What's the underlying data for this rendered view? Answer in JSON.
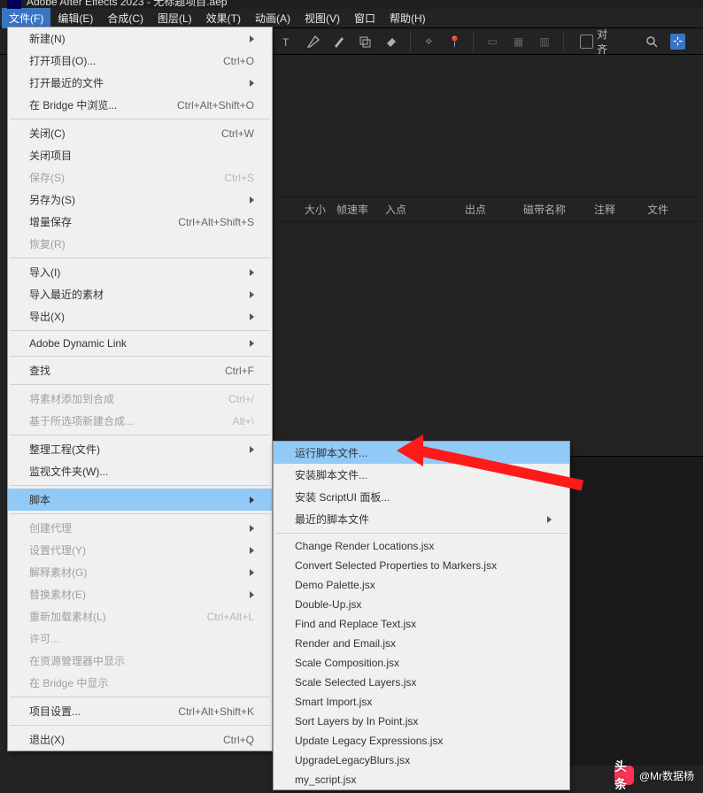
{
  "titlebar": {
    "app": "Adobe After Effects 2023",
    "project": "无标题项目.aep"
  },
  "menubar": {
    "items": [
      {
        "label": "文件(F)",
        "active": true
      },
      {
        "label": "编辑(E)"
      },
      {
        "label": "合成(C)"
      },
      {
        "label": "图层(L)"
      },
      {
        "label": "效果(T)"
      },
      {
        "label": "动画(A)"
      },
      {
        "label": "视图(V)"
      },
      {
        "label": "窗口"
      },
      {
        "label": "帮助(H)"
      }
    ]
  },
  "toolbar": {
    "align_label": "对齐"
  },
  "file_menu": {
    "items": [
      {
        "label": "新建(N)",
        "submenu": true
      },
      {
        "label": "打开项目(O)...",
        "shortcut": "Ctrl+O"
      },
      {
        "label": "打开最近的文件",
        "submenu": true
      },
      {
        "label": "在 Bridge 中浏览...",
        "shortcut": "Ctrl+Alt+Shift+O"
      },
      {
        "sep": true
      },
      {
        "label": "关闭(C)",
        "shortcut": "Ctrl+W"
      },
      {
        "label": "关闭项目"
      },
      {
        "label": "保存(S)",
        "shortcut": "Ctrl+S",
        "disabled": true
      },
      {
        "label": "另存为(S)",
        "submenu": true
      },
      {
        "label": "增量保存",
        "shortcut": "Ctrl+Alt+Shift+S"
      },
      {
        "label": "恢复(R)",
        "disabled": true
      },
      {
        "sep": true
      },
      {
        "label": "导入(I)",
        "submenu": true
      },
      {
        "label": "导入最近的素材",
        "submenu": true
      },
      {
        "label": "导出(X)",
        "submenu": true
      },
      {
        "sep": true
      },
      {
        "label": "Adobe Dynamic Link",
        "submenu": true
      },
      {
        "sep": true
      },
      {
        "label": "查找",
        "shortcut": "Ctrl+F"
      },
      {
        "sep": true
      },
      {
        "label": "将素材添加到合成",
        "shortcut": "Ctrl+/",
        "disabled": true
      },
      {
        "label": "基于所选项新建合成...",
        "shortcut": "Alt+\\",
        "disabled": true
      },
      {
        "sep": true
      },
      {
        "label": "整理工程(文件)",
        "submenu": true
      },
      {
        "label": "监视文件夹(W)..."
      },
      {
        "sep": true
      },
      {
        "label": "脚本",
        "submenu": true,
        "highlighted": true
      },
      {
        "sep": true
      },
      {
        "label": "创建代理",
        "submenu": true,
        "disabled": true
      },
      {
        "label": "设置代理(Y)",
        "submenu": true,
        "disabled": true
      },
      {
        "label": "解释素材(G)",
        "submenu": true,
        "disabled": true
      },
      {
        "label": "替换素材(E)",
        "submenu": true,
        "disabled": true
      },
      {
        "label": "重新加载素材(L)",
        "shortcut": "Ctrl+Alt+L",
        "disabled": true
      },
      {
        "label": "许可...",
        "disabled": true
      },
      {
        "label": "在资源管理器中显示",
        "disabled": true
      },
      {
        "label": "在 Bridge 中显示",
        "disabled": true
      },
      {
        "sep": true
      },
      {
        "label": "项目设置...",
        "shortcut": "Ctrl+Alt+Shift+K"
      },
      {
        "sep": true
      },
      {
        "label": "退出(X)",
        "shortcut": "Ctrl+Q"
      }
    ]
  },
  "script_menu": {
    "items": [
      {
        "label": "运行脚本文件...",
        "highlighted": true
      },
      {
        "label": "安装脚本文件..."
      },
      {
        "label": "安装 ScriptUI 面板..."
      },
      {
        "label": "最近的脚本文件",
        "submenu": true
      },
      {
        "sep": true
      },
      {
        "label": "Change Render Locations.jsx"
      },
      {
        "label": "Convert Selected Properties to Markers.jsx"
      },
      {
        "label": "Demo Palette.jsx"
      },
      {
        "label": "Double-Up.jsx"
      },
      {
        "label": "Find and Replace Text.jsx"
      },
      {
        "label": "Render and Email.jsx"
      },
      {
        "label": "Scale Composition.jsx"
      },
      {
        "label": "Scale Selected Layers.jsx"
      },
      {
        "label": "Smart Import.jsx"
      },
      {
        "label": "Sort Layers by In Point.jsx"
      },
      {
        "label": "Update Legacy Expressions.jsx"
      },
      {
        "label": "UpgradeLegacyBlurs.jsx"
      },
      {
        "label": "my_script.jsx"
      }
    ]
  },
  "project_columns": {
    "size": "大小",
    "fps": "帧速率",
    "in": "入点",
    "out": "出点",
    "tape": "磁带名称",
    "comment": "注释",
    "file": "文件"
  },
  "watermark": {
    "label": "头条",
    "author": "@Mr数据杨"
  }
}
